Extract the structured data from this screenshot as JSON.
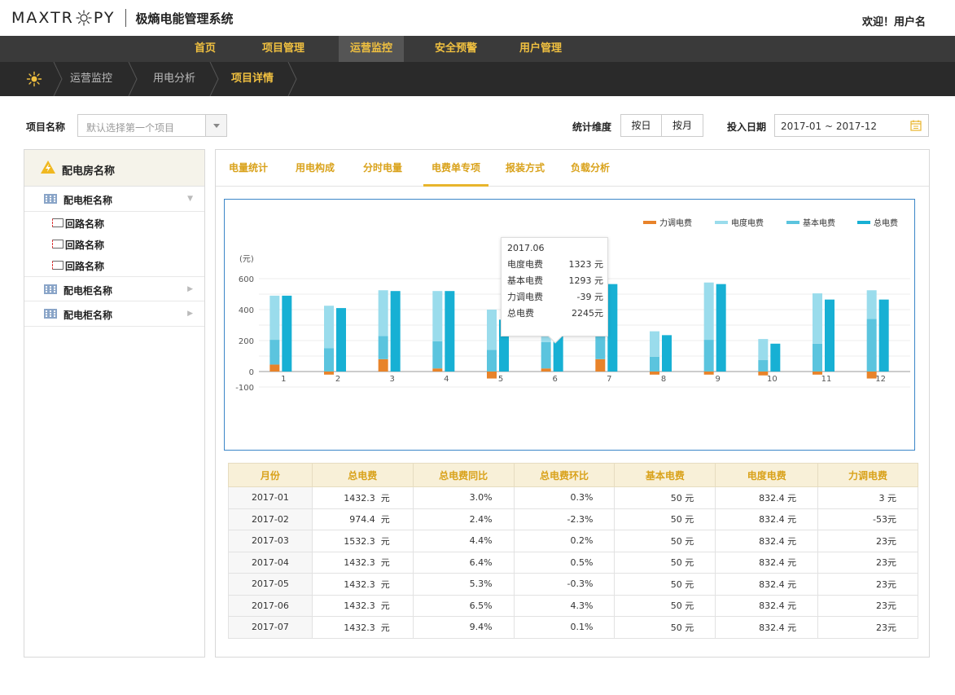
{
  "header": {
    "logo_left": "MAXTR",
    "logo_right": "PY",
    "system_name": "极熵电能管理系统",
    "welcome": "欢迎！用户名"
  },
  "nav": {
    "items": [
      {
        "label": "首页"
      },
      {
        "label": "项目管理"
      },
      {
        "label": "运营监控",
        "active": true
      },
      {
        "label": "安全预警"
      },
      {
        "label": "用户管理"
      }
    ]
  },
  "breadcrumb": [
    "运营监控",
    "用电分析",
    "项目详情"
  ],
  "filters": {
    "project_label": "项目名称",
    "project_placeholder": "默认选择第一个项目",
    "dimension_label": "统计维度",
    "by_day": "按日",
    "by_month": "按月",
    "date_label": "投入日期",
    "date_range": "2017-01 ~ 2017-12"
  },
  "sidebar": {
    "room": "配电房名称",
    "cabinets": [
      {
        "label": "配电柜名称",
        "expanded": true,
        "loops": [
          "回路名称",
          "回路名称",
          "回路名称"
        ]
      },
      {
        "label": "配电柜名称",
        "expanded": false
      },
      {
        "label": "配电柜名称",
        "expanded": false
      }
    ]
  },
  "tabs": [
    {
      "label": "电量统计"
    },
    {
      "label": "用电构成"
    },
    {
      "label": "分时电量"
    },
    {
      "label": "电费单专项",
      "active": true
    },
    {
      "label": "报装方式"
    },
    {
      "label": "负载分析"
    }
  ],
  "tooltip": {
    "title": "2017.06",
    "rows": [
      {
        "name": "电度电费",
        "value": "1323 元"
      },
      {
        "name": "基本电费",
        "value": "1293 元"
      },
      {
        "name": "力调电费",
        "value": "-39 元"
      },
      {
        "name": "总电费",
        "value": "2245元"
      }
    ]
  },
  "chart_data": {
    "type": "bar",
    "ylabel": "(元)",
    "ylim": [
      -100,
      600
    ],
    "yticks": [
      600,
      400,
      200,
      0,
      -100
    ],
    "categories": [
      "1",
      "2",
      "3",
      "4",
      "5",
      "6",
      "7",
      "8",
      "9",
      "10",
      "11",
      "12"
    ],
    "legend_position": "top-right",
    "series": [
      {
        "name": "力调电费",
        "color": "#e8832a",
        "values": [
          45,
          -20,
          80,
          20,
          -45,
          20,
          80,
          -20,
          -20,
          -25,
          -20,
          -45
        ]
      },
      {
        "name": "电度电费",
        "color": "#9adcec",
        "values": [
          285,
          275,
          295,
          325,
          260,
          315,
          320,
          165,
          370,
          135,
          325,
          185
        ]
      },
      {
        "name": "基本电费",
        "color": "#5bc4de",
        "values": [
          160,
          150,
          150,
          175,
          140,
          170,
          170,
          95,
          205,
          75,
          180,
          340
        ]
      },
      {
        "name": "总电费",
        "color": "#17b0d4",
        "values": [
          490,
          410,
          520,
          520,
          335,
          500,
          565,
          235,
          565,
          180,
          465,
          465
        ]
      }
    ]
  },
  "table": {
    "headers": [
      "月份",
      "总电费",
      "总电费同比",
      "总电费环比",
      "基本电费",
      "电度电费",
      "力调电费"
    ],
    "rows": [
      [
        "2017-01",
        "1432.3  元",
        "3.0%",
        "0.3%",
        "50 元",
        "832.4 元",
        "3 元"
      ],
      [
        "2017-02",
        "974.4  元",
        "2.4%",
        "-2.3%",
        "50 元",
        "832.4 元",
        "-53元"
      ],
      [
        "2017-03",
        "1532.3  元",
        "4.4%",
        "0.2%",
        "50 元",
        "832.4 元",
        "23元"
      ],
      [
        "2017-04",
        "1432.3  元",
        "6.4%",
        "0.5%",
        "50 元",
        "832.4 元",
        "23元"
      ],
      [
        "2017-05",
        "1432.3  元",
        "5.3%",
        "-0.3%",
        "50 元",
        "832.4 元",
        "23元"
      ],
      [
        "2017-06",
        "1432.3  元",
        "6.5%",
        "4.3%",
        "50 元",
        "832.4 元",
        "23元"
      ],
      [
        "2017-07",
        "1432.3  元",
        "9.4%",
        "0.1%",
        "50 元",
        "832.4 元",
        "23元"
      ]
    ]
  },
  "colors": {
    "accent": "#e8b52c",
    "nav_bg": "#3a3a3a",
    "crumb_bg": "#2a2a2a",
    "tab_text": "#d9a21b"
  }
}
